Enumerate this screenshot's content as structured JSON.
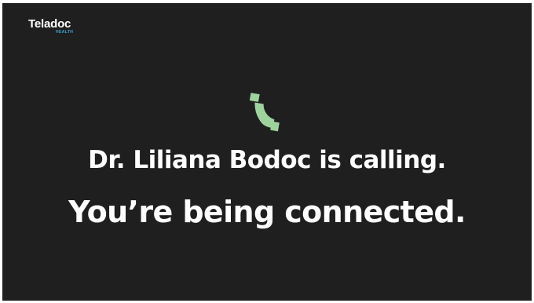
{
  "brand": {
    "name": "Teladoc",
    "subtitle": "HEALTH",
    "accent_color": "#3aa6d8"
  },
  "call": {
    "icon": "phone-icon",
    "icon_color": "#9fd39e",
    "caller_message": "Dr. Liliana Bodoc is calling.",
    "status_message": "You’re being connected."
  },
  "colors": {
    "background": "#1f1f1f",
    "text": "#ffffff"
  }
}
